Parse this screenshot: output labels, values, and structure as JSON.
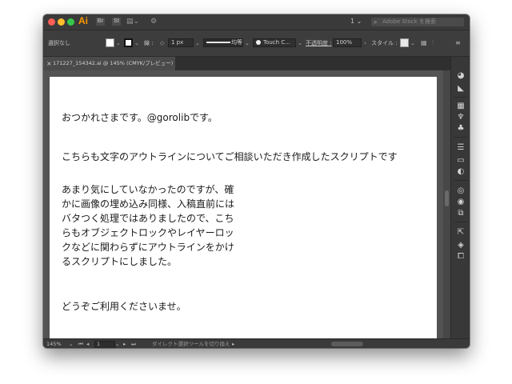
{
  "titlebar": {
    "app_logo": "Ai",
    "bridge_label": "Br",
    "stock_label": "St",
    "workspace": "1 ⌄",
    "stock_search_placeholder": "Adobe Stock を検索"
  },
  "controlbar": {
    "selection_label": "選択なし",
    "stroke_label": "線 :",
    "stroke_weight": "1 px",
    "stroke_profile": "均等",
    "brush_label": "Touch C...",
    "opacity_label": "不透明度 :",
    "opacity_value": "100%",
    "style_label": "スタイル :"
  },
  "document_tab": {
    "close_glyph": "×",
    "title": "171227_154342.ai @ 145% (CMYK/プレビュー)"
  },
  "artboard": {
    "line1": "おつかれさまです。@gorolibです。",
    "line2": "こちらも文字のアウトラインについてご相談いただき作成したスクリプトです",
    "paragraph": [
      "あまり気にしていなかったのですが、確",
      "かに画像の埋め込み同様、入稿直前には",
      "バタつく処理ではありましたので、こち",
      "らもオブジェクトロックやレイヤーロッ",
      "クなどに関わらずにアウトラインをかけ",
      "るスクリプトにしました。"
    ],
    "line_last": "どうぞご利用くださいませ。"
  },
  "statusbar": {
    "zoom": "145%",
    "artboard_number": "1",
    "tool_status": "ダイレクト選択ツールを切り換え"
  },
  "colors": {
    "accent_logo": "#ff9a00",
    "chrome_dark": "#3a3a3a",
    "canvas_bg": "#535353",
    "artboard": "#ffffff"
  }
}
